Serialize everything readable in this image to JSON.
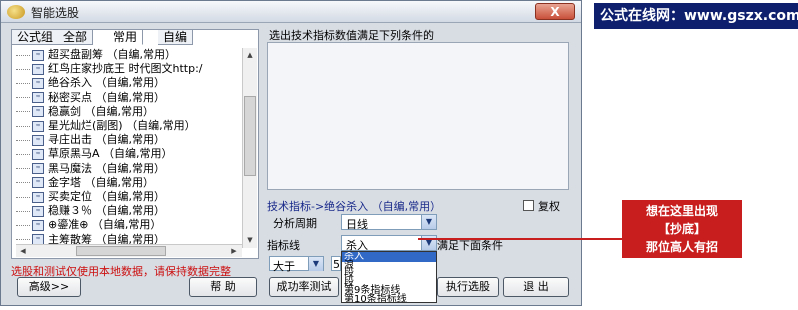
{
  "window": {
    "title": "智能选股",
    "close_label": "X"
  },
  "tabs": [
    {
      "label": "公式组"
    },
    {
      "label": "全部"
    },
    {
      "label": "常用",
      "active": true
    },
    {
      "label": "自编"
    }
  ],
  "formula_list": [
    "超买盘副筹 （自编,常用）",
    "红鸟庄家抄底王 时代图文http:/",
    "绝谷杀入 （自编,常用）",
    "秘密买点 （自编,常用）",
    "稳赢剑 （自编,常用）",
    "星光灿烂(副图) （自编,常用）",
    "寻庄出击 （自编,常用）",
    "草原黑马A （自编,常用）",
    "黑马魔法 （自编,常用）",
    "金字塔 （自编,常用）",
    "买卖定位 （自编,常用）",
    "稳赚３％ （自编,常用）",
    "⊕鎏准⊕ （自编,常用）",
    "主筹散筹 （自编,常用）"
  ],
  "criteria": {
    "label": "选出技术指标数值满足下列条件的"
  },
  "indicator": {
    "name": "技术指标->绝谷杀入 （自编,常用）",
    "checkbox_label": "复权",
    "period_label": "分析周期",
    "period_value": "日线",
    "line_label": "指标线",
    "line_value": "杀入",
    "satisfy_text": "满足下面条件",
    "line_options": [
      "杀入",
      "浪",
      "段",
      "段",
      "第9条指标线",
      "第10条指标线"
    ],
    "selected_option": 0,
    "compare_value": "大于",
    "value_text": "5"
  },
  "warning": "选股和测试仅使用本地数据，请保持数据完整",
  "buttons": {
    "advanced": "高级>>",
    "help": "帮 助",
    "success_test": "成功率测试",
    "execute": "执行选股",
    "exit": "退 出"
  },
  "site_banner": "公式在线网：www.gszx.com.cn",
  "note": [
    "想在这里出现",
    "【抄底】",
    "那位高人有招"
  ],
  "colors": {
    "note_bg": "#c81e1e",
    "banner_bg": "#0e1f6e",
    "selection": "#3169c6"
  }
}
